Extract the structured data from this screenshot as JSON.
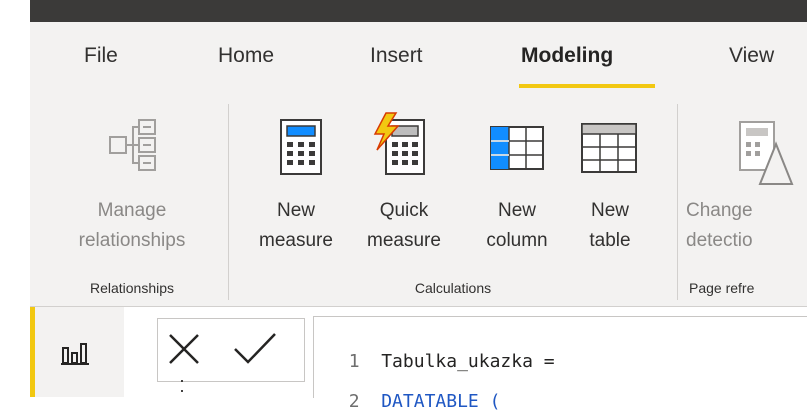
{
  "tabs": [
    "File",
    "Home",
    "Insert",
    "Modeling",
    "View"
  ],
  "active_tab": "Modeling",
  "groups": {
    "relationships": {
      "label": "Relationships",
      "buttons": [
        {
          "line1": "Manage",
          "line2": "relationships",
          "icon": "manage-relationships-icon",
          "disabled": true
        }
      ]
    },
    "calculations": {
      "label": "Calculations",
      "buttons": [
        {
          "line1": "New",
          "line2": "measure",
          "icon": "calculator-icon"
        },
        {
          "line1": "Quick",
          "line2": "measure",
          "icon": "lightning-calculator-icon"
        },
        {
          "line1": "New",
          "line2": "column",
          "icon": "table-column-icon"
        },
        {
          "line1": "New",
          "line2": "table",
          "icon": "table-icon"
        }
      ]
    },
    "page_refresh": {
      "label": "Page refre",
      "buttons": [
        {
          "line1": "Change",
          "line2": "detectio",
          "icon": "change-detection-icon",
          "disabled": true
        }
      ]
    }
  },
  "formula": {
    "lines": [
      {
        "num": "1",
        "text": "Tabulka_ukazka ="
      },
      {
        "num": "2",
        "text": "DATATABLE ("
      }
    ]
  },
  "colors": {
    "accent": "#f2c811",
    "keyword": "#1f57c3",
    "titlebar": "#3b3a39",
    "ribbon": "#f3f2f1"
  }
}
